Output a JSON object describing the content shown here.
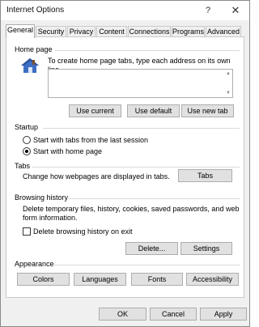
{
  "window": {
    "title": "Internet Options",
    "help": "?",
    "close": "✕"
  },
  "tabs": [
    {
      "label": "General",
      "active": true
    },
    {
      "label": "Security",
      "active": false
    },
    {
      "label": "Privacy",
      "active": false
    },
    {
      "label": "Content",
      "active": false
    },
    {
      "label": "Connections",
      "active": false
    },
    {
      "label": "Programs",
      "active": false
    },
    {
      "label": "Advanced",
      "active": false
    }
  ],
  "home_page": {
    "heading": "Home page",
    "description": "To create home page tabs, type each address on its own line.",
    "urls": "",
    "use_current": "Use current",
    "use_default": "Use default",
    "use_new_tab": "Use new tab"
  },
  "startup": {
    "heading": "Startup",
    "option_last_session": "Start with tabs from the last session",
    "option_home_page": "Start with home page",
    "selected": "home_page"
  },
  "tabs_section": {
    "heading": "Tabs",
    "description": "Change how webpages are displayed in tabs.",
    "button": "Tabs"
  },
  "browsing_history": {
    "heading": "Browsing history",
    "description_line1": "Delete temporary files, history, cookies, saved passwords, and web",
    "description_line2": "form information.",
    "delete_on_exit_label": "Delete browsing history on exit",
    "delete_on_exit_checked": false,
    "delete_button": "Delete...",
    "settings_button": "Settings"
  },
  "appearance": {
    "heading": "Appearance",
    "colors": "Colors",
    "languages": "Languages",
    "fonts": "Fonts",
    "accessibility": "Accessibility"
  },
  "footer": {
    "ok": "OK",
    "cancel": "Cancel",
    "apply": "Apply"
  }
}
